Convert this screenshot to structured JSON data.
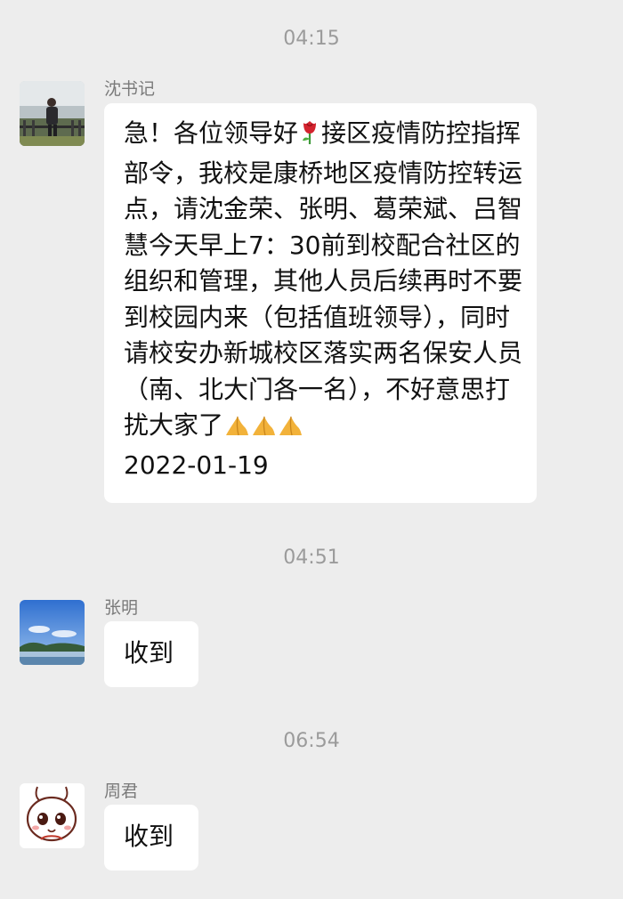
{
  "messages": [
    {
      "time": "04:15",
      "sender": "沈书记",
      "text_before_rose": "急！各位领导好",
      "text_after_rose": "接区疫情防控指挥部令，我校是康桥地区疫情防控转运点，请沈金荣、张明、葛荣斌、吕智慧今天早上7：30前到校配合社区的组织和管理，其他人员后续再时不要到校园内来（包括值班领导），同时请校安办新城校区落实两名保安人员（南、北大门各一名），不好意思打扰大家了",
      "date": "2022-01-19",
      "emoji_icons": [
        "rose-icon",
        "folded-hands-icon",
        "folded-hands-icon",
        "folded-hands-icon"
      ]
    },
    {
      "time": "04:51",
      "sender": "张明",
      "text": "收到"
    },
    {
      "time": "06:54",
      "sender": "周君",
      "text": "收到"
    }
  ],
  "colors": {
    "background": "#ededed",
    "bubble": "#ffffff",
    "timestamp": "#9b9b9b",
    "sender_name": "#7a7a7a",
    "message_text": "#111111"
  }
}
